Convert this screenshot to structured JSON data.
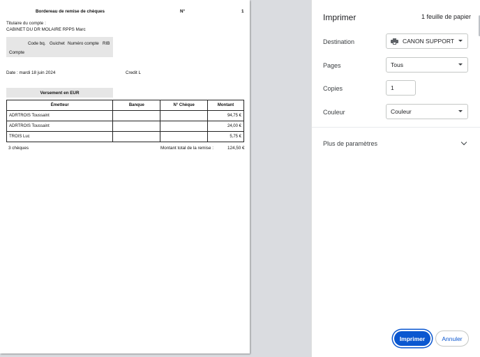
{
  "document": {
    "title": "Bordereau de remise de chèques",
    "no_label": "N°",
    "no_value": "1",
    "holder_label": "Titulaire du compte :",
    "holder_name": "CABINET DU DR MOLAIRE RPPS Marc",
    "bank_headers": [
      "Code bq.",
      "Guichet",
      "Numéro compte",
      "RIB"
    ],
    "account_label": "Compte",
    "date_text": "Date : mardi 18 juin 2024",
    "credit_text": "Credit L",
    "versement_label": "Versement en EUR",
    "table_headers": [
      "Émetteur",
      "Banque",
      "N° Chèque",
      "Montant"
    ],
    "rows": [
      {
        "emetteur": "ADRTROIS Toussaint",
        "banque": "",
        "cheque": "",
        "montant": "94,75 €"
      },
      {
        "emetteur": "ADRTROIS Toussaint",
        "banque": "",
        "cheque": "",
        "montant": "24,00 €"
      },
      {
        "emetteur": "TROIS Luc",
        "banque": "",
        "cheque": "",
        "montant": "5,75 €"
      }
    ],
    "count_text": "3 chèques",
    "total_label": "Montant total de la remise :",
    "total_value": "124,50 €"
  },
  "panel": {
    "title": "Imprimer",
    "sheets": "1 feuille de papier",
    "destination_label": "Destination",
    "destination_value": "CANON SUPPORT",
    "pages_label": "Pages",
    "pages_value": "Tous",
    "copies_label": "Copies",
    "copies_value": "1",
    "color_label": "Couleur",
    "color_value": "Couleur",
    "more_settings": "Plus de paramètres",
    "print_button": "Imprimer",
    "cancel_button": "Annuler"
  },
  "colors": {
    "accent": "#0b57d0",
    "background": "#dadce0"
  },
  "icons": {
    "destination": "printer-icon",
    "dropdown": "chevron-down-icon"
  }
}
